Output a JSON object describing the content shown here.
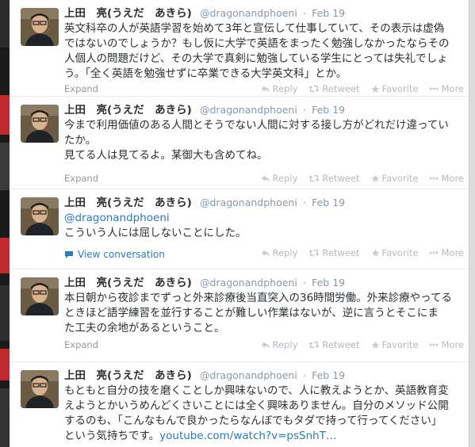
{
  "tweets": [
    {
      "fullname": "上田　亮(うえだ　あきら)",
      "username": "@dragonandphoeni",
      "separator": "·",
      "time": "Feb 19",
      "lines": [
        "英文科卒の人が英語学習を始めて3年と宣伝して仕事していて、その表示は虚偽",
        "ではないのでしょうか？もし仮に大学で英語をまったく勉強しなかったならその",
        "人個人の問題だけど、その大学で真剣に勉強している学生にとっては失礼でしょ",
        "う。「全く英語を勉強せずに卒業できる大学英文科」とか。"
      ],
      "footer": "Expand"
    },
    {
      "fullname": "上田　亮(うえだ　あきら)",
      "username": "@dragonandphoeni",
      "separator": "·",
      "time": "Feb 19",
      "lines": [
        "今まで利用価値のある人間とそうでない人間に対する接し方がどれだけ違ってい",
        "たか。",
        "見てる人は見てるよ。某御大も含めてね。"
      ],
      "footer": "Expand"
    },
    {
      "fullname": "上田　亮(うえだ　あきら)",
      "username": "@dragonandphoeni",
      "separator": "·",
      "time": "Feb 19",
      "mention": "@dragonandphoeni",
      "lines": [
        "こういう人には屈しないことにした。"
      ],
      "footer": "View conversation"
    },
    {
      "fullname": "上田　亮(うえだ　あきら)",
      "username": "@dragonandphoeni",
      "separator": "·",
      "time": "Feb 19",
      "lines": [
        "本日朝から夜診までずっと外来診療後当直突入の36時間労働。外来診療やってる",
        "ときほど語学練習を並行することが難しい作業はないが、逆に言うとそこにま",
        "た工夫の余地があるということ。"
      ],
      "footer": "Expand"
    },
    {
      "fullname": "上田　亮(うえだ　あきら)",
      "username": "@dragonandphoeni",
      "separator": "·",
      "time": "Feb 19",
      "lines": [
        "もともと自分の技を磨くことしか興味ないので、人に教えようとか、英語教育変",
        "えようとかいうめんどくさいことには全く興味ありません。自分のメソッド公開",
        "するのも、「こんなもんで良かったらなんぼでもタダで持って行ってください」"
      ],
      "last_line_text": "という気持ちです。",
      "last_line_link": "youtube.com/watch?v=psSnhT…"
    }
  ],
  "actions": {
    "reply": "Reply",
    "retweet": "Retweet",
    "favorite": "Favorite",
    "more": "More"
  },
  "colors": {
    "link": "#2b7bb9",
    "muted": "#8899a6",
    "action": "#b1bbc3"
  },
  "icons": {
    "reply": "reply-arrow-icon",
    "retweet": "retweet-arrows-icon",
    "favorite": "star-icon",
    "more": "ellipsis-icon",
    "conversation": "speech-bubble-icon"
  }
}
